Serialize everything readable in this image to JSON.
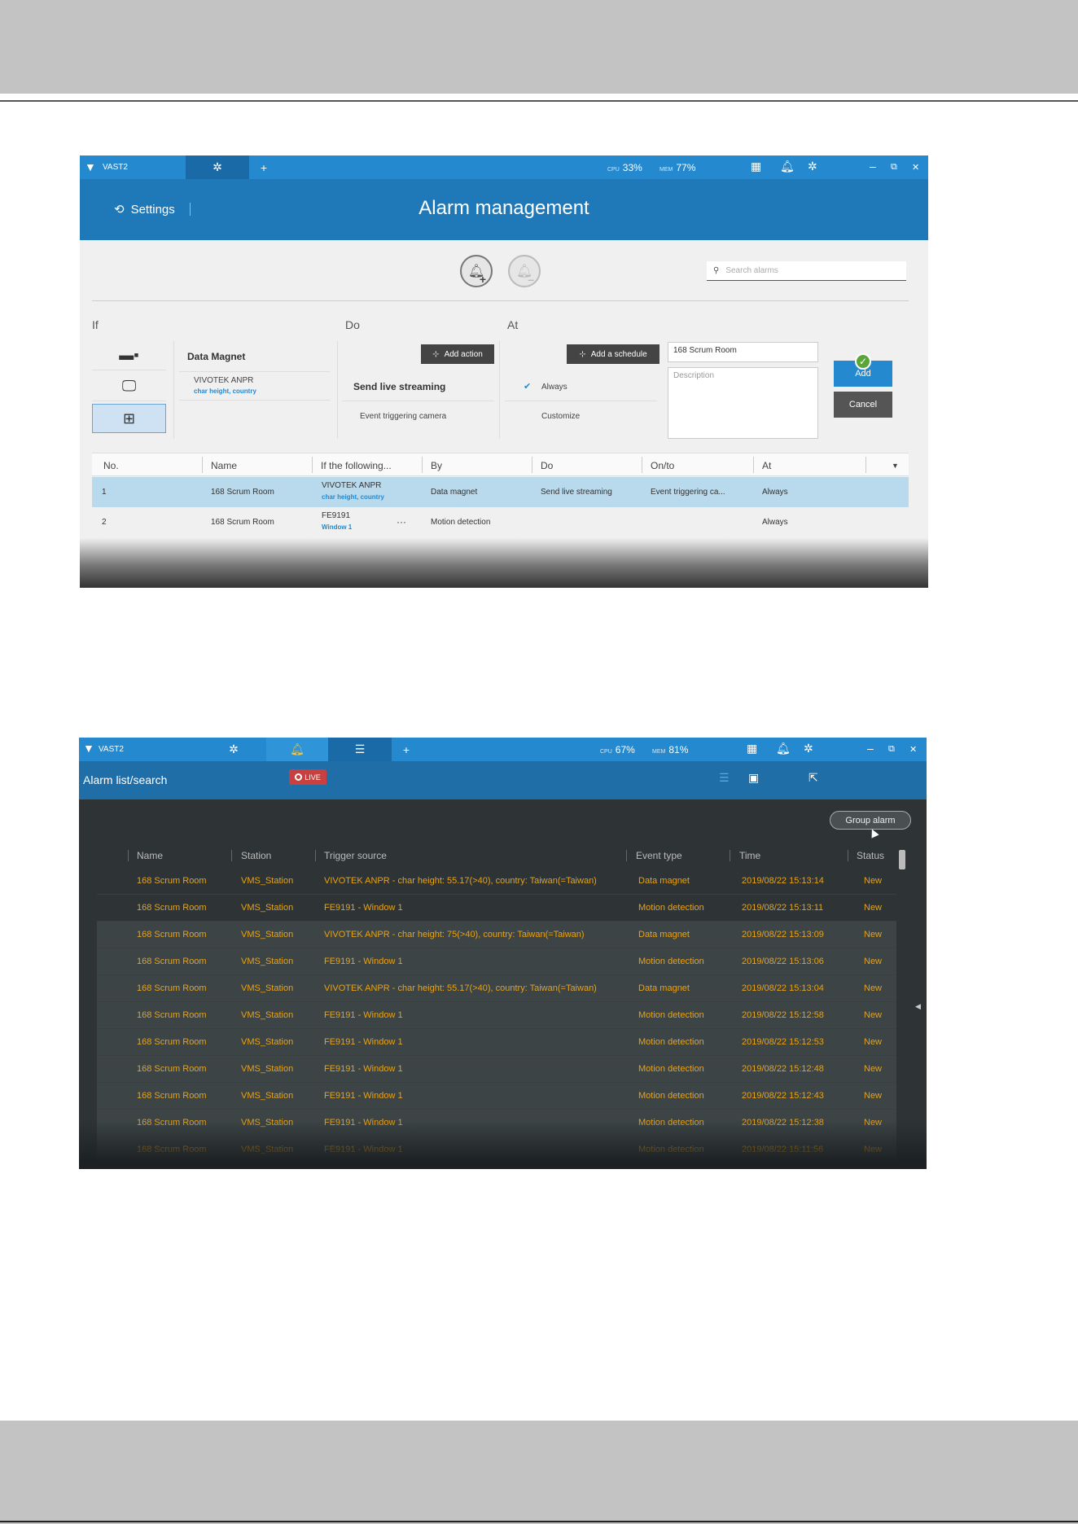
{
  "shot1": {
    "app_name": "VAST2",
    "tabs": [
      {
        "icon": "gear-icon"
      },
      {
        "label": "+"
      }
    ],
    "cpu_label": "CPU",
    "cpu": "33%",
    "mem_label": "MEM",
    "mem": "77%",
    "header": {
      "settings_label": "Settings",
      "title": "Alarm management"
    },
    "search_placeholder": "Search alarms",
    "sections": {
      "if": "If",
      "do": "Do",
      "at": "At"
    },
    "if_panel": {
      "title": "Data Magnet",
      "item_name": "VIVOTEK ANPR",
      "item_sub": "char height, country"
    },
    "do_panel": {
      "add_action": "Add action",
      "action": "Send live streaming",
      "target": "Event triggering camera"
    },
    "at_panel": {
      "add_schedule": "Add a schedule",
      "always": "Always",
      "customize": "Customize"
    },
    "name_field": "168 Scrum Room",
    "description_placeholder": "Description",
    "add_label": "Add",
    "cancel_label": "Cancel",
    "columns": [
      "No.",
      "Name",
      "If the following...",
      "By",
      "Do",
      "On/to",
      "At"
    ],
    "rows": [
      {
        "no": "1",
        "name": "168 Scrum Room",
        "if": "VIVOTEK ANPR",
        "if_sub": "char height, country",
        "by": "Data magnet",
        "do": "Send live streaming",
        "on": "Event triggering ca...",
        "at": "Always"
      },
      {
        "no": "2",
        "name": "168 Scrum Room",
        "if": "FE9191",
        "if_sub": "Window 1",
        "more": "···",
        "by": "Motion detection",
        "do": "",
        "on": "",
        "at": "Always"
      }
    ]
  },
  "shot2": {
    "app_name": "VAST2",
    "cpu_label": "CPU",
    "cpu": "67%",
    "mem_label": "MEM",
    "mem": "81%",
    "title": "Alarm list/search",
    "live_label": "LIVE",
    "group_alarm": "Group alarm",
    "columns": [
      "Name",
      "Station",
      "Trigger source",
      "Event type",
      "Time",
      "Status"
    ],
    "rows": [
      {
        "name": "168 Scrum Room",
        "station": "VMS_Station",
        "source": "VIVOTEK ANPR - char height: 55.17(>40), country: Taiwan(=Taiwan)",
        "type": "Data magnet",
        "time": "2019/08/22 15:13:14",
        "status": "New"
      },
      {
        "name": "168 Scrum Room",
        "station": "VMS_Station",
        "source": "FE9191 - Window 1",
        "type": "Motion detection",
        "time": "2019/08/22 15:13:11",
        "status": "New"
      },
      {
        "name": "168 Scrum Room",
        "station": "VMS_Station",
        "source": "VIVOTEK ANPR - char height: 75(>40), country: Taiwan(=Taiwan)",
        "type": "Data magnet",
        "time": "2019/08/22 15:13:09",
        "status": "New"
      },
      {
        "name": "168 Scrum Room",
        "station": "VMS_Station",
        "source": "FE9191 - Window 1",
        "type": "Motion detection",
        "time": "2019/08/22 15:13:06",
        "status": "New"
      },
      {
        "name": "168 Scrum Room",
        "station": "VMS_Station",
        "source": "VIVOTEK ANPR - char height: 55.17(>40), country: Taiwan(=Taiwan)",
        "type": "Data magnet",
        "time": "2019/08/22 15:13:04",
        "status": "New"
      },
      {
        "name": "168 Scrum Room",
        "station": "VMS_Station",
        "source": "FE9191 - Window 1",
        "type": "Motion detection",
        "time": "2019/08/22 15:12:58",
        "status": "New"
      },
      {
        "name": "168 Scrum Room",
        "station": "VMS_Station",
        "source": "FE9191 - Window 1",
        "type": "Motion detection",
        "time": "2019/08/22 15:12:53",
        "status": "New"
      },
      {
        "name": "168 Scrum Room",
        "station": "VMS_Station",
        "source": "FE9191 - Window 1",
        "type": "Motion detection",
        "time": "2019/08/22 15:12:48",
        "status": "New"
      },
      {
        "name": "168 Scrum Room",
        "station": "VMS_Station",
        "source": "FE9191 - Window 1",
        "type": "Motion detection",
        "time": "2019/08/22 15:12:43",
        "status": "New"
      },
      {
        "name": "168 Scrum Room",
        "station": "VMS_Station",
        "source": "FE9191 - Window 1",
        "type": "Motion detection",
        "time": "2019/08/22 15:12:38",
        "status": "New"
      },
      {
        "name": "168 Scrum Room",
        "station": "VMS_Station",
        "source": "FE9191 - Window 1",
        "type": "Motion detection",
        "time": "2019/08/22 15:11:56",
        "status": "New"
      }
    ]
  },
  "colors": {
    "accent": "#2489cf",
    "header_dark": "#1f78b8",
    "alarm_text": "#e7a219",
    "live_red": "#c84040"
  }
}
